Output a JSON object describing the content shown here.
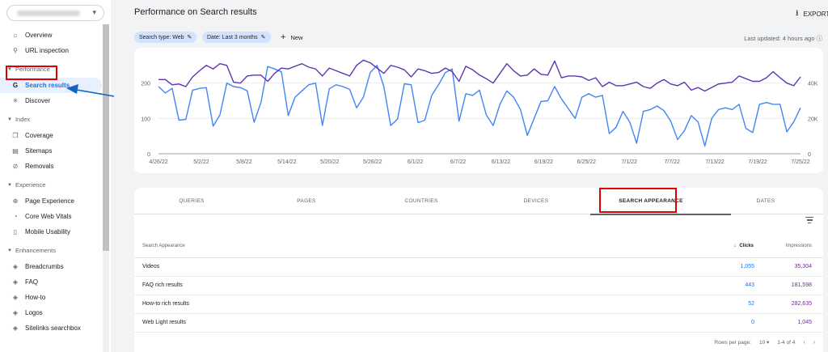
{
  "header": {
    "title": "Performance on Search results",
    "export_label": "EXPORT"
  },
  "sidebar": {
    "top_items": [
      {
        "label": "Overview",
        "icon": "home-icon"
      },
      {
        "label": "URL inspection",
        "icon": "search-icon"
      }
    ],
    "performance": {
      "section": "Performance",
      "items": [
        {
          "label": "Search results",
          "icon": "google-g-icon",
          "active": true
        },
        {
          "label": "Discover",
          "icon": "asterisk-icon"
        }
      ]
    },
    "index": {
      "section": "Index",
      "items": [
        {
          "label": "Coverage",
          "icon": "file-copy-icon"
        },
        {
          "label": "Sitemaps",
          "icon": "sitemap-icon"
        },
        {
          "label": "Removals",
          "icon": "eye-off-icon"
        }
      ]
    },
    "experience": {
      "section": "Experience",
      "items": [
        {
          "label": "Page Experience",
          "icon": "plus-circle-icon"
        },
        {
          "label": "Core Web Vitals",
          "icon": "gauge-icon"
        },
        {
          "label": "Mobile Usability",
          "icon": "phone-icon"
        }
      ]
    },
    "enhancements": {
      "section": "Enhancements",
      "items": [
        {
          "label": "Breadcrumbs",
          "icon": "layers-icon"
        },
        {
          "label": "FAQ",
          "icon": "layers-icon"
        },
        {
          "label": "How-to",
          "icon": "layers-icon"
        },
        {
          "label": "Logos",
          "icon": "layers-icon"
        },
        {
          "label": "Sitelinks searchbox",
          "icon": "layers-icon"
        }
      ]
    }
  },
  "filters": {
    "search_type": "Search type: Web",
    "date": "Date: Last 3 months",
    "new_label": "New",
    "last_updated": "Last updated: 4 hours ago"
  },
  "chart_data": {
    "type": "line",
    "x": [
      "4/26/22",
      "5/2/22",
      "5/8/22",
      "5/14/22",
      "5/20/22",
      "5/26/22",
      "6/1/22",
      "6/7/22",
      "6/13/22",
      "6/19/22",
      "6/25/22",
      "7/1/22",
      "7/7/22",
      "7/13/22",
      "7/19/22",
      "7/25/22"
    ],
    "y_left": {
      "ticks": [
        "0",
        "100",
        "200"
      ],
      "range": [
        0,
        300
      ]
    },
    "y_right": {
      "ticks": [
        "0",
        "20K",
        "40K"
      ],
      "range": [
        0,
        60000
      ]
    },
    "grid": true,
    "series": [
      {
        "color": "#4285f4",
        "axis": "left",
        "values": [
          190,
          172,
          185,
          95,
          97,
          180,
          185,
          187,
          78,
          110,
          200,
          190,
          187,
          178,
          89,
          145,
          247,
          240,
          232,
          108,
          160,
          178,
          195,
          200,
          80,
          184,
          195,
          190,
          182,
          130,
          160,
          230,
          250,
          190,
          80,
          98,
          198,
          195,
          88,
          95,
          165,
          195,
          230,
          240,
          92,
          170,
          165,
          180,
          110,
          80,
          140,
          178,
          160,
          125,
          52,
          100,
          148,
          150,
          190,
          155,
          128,
          100,
          160,
          170,
          160,
          165,
          57,
          75,
          120,
          90,
          30,
          120,
          125,
          135,
          122,
          92,
          40,
          65,
          108,
          90,
          22,
          100,
          125,
          130,
          125,
          140,
          72,
          60,
          140,
          145,
          140,
          140,
          62,
          90,
          130
        ]
      },
      {
        "color": "#5e35b1",
        "axis": "right",
        "values": [
          42000,
          42000,
          39000,
          39500,
          38000,
          43500,
          47000,
          50000,
          48000,
          51000,
          50000,
          40500,
          40000,
          44000,
          44500,
          44500,
          41000,
          45500,
          48500,
          48000,
          49500,
          51000,
          49000,
          48000,
          44000,
          48500,
          47000,
          45500,
          44000,
          50000,
          53000,
          51500,
          48500,
          45500,
          50000,
          49000,
          47500,
          43500,
          48000,
          47000,
          45500,
          46000,
          48500,
          46500,
          41000,
          49500,
          47500,
          44500,
          42500,
          40000,
          45500,
          51000,
          47000,
          44000,
          44500,
          48000,
          45000,
          44500,
          52500,
          43000,
          44000,
          44000,
          43500,
          41500,
          43000,
          38000,
          40500,
          38500,
          38500,
          39500,
          40500,
          38000,
          37000,
          40000,
          42000,
          39500,
          38500,
          40500,
          36000,
          37500,
          35500,
          37500,
          39500,
          40000,
          40500,
          44000,
          42500,
          41000,
          41000,
          43000,
          46500,
          43000,
          40000,
          38500,
          43500
        ]
      }
    ]
  },
  "tabs": [
    "QUERIES",
    "PAGES",
    "COUNTRIES",
    "DEVICES",
    "SEARCH APPEARANCE",
    "DATES"
  ],
  "table": {
    "headers": {
      "name": "Search Appearance",
      "clicks": "Clicks",
      "impressions": "Impressions"
    },
    "rows": [
      {
        "name": "Videos",
        "clicks": "1,055",
        "impressions": "35,304"
      },
      {
        "name": "FAQ rich results",
        "clicks": "443",
        "impressions": "181,598"
      },
      {
        "name": "How-to rich results",
        "clicks": "52",
        "impressions": "282,635"
      },
      {
        "name": "Web Light results",
        "clicks": "0",
        "impressions": "1,045"
      }
    ]
  },
  "pagination": {
    "rows_label": "Rows per page:",
    "rows_value": "10",
    "range": "1-4 of 4"
  },
  "colors": {
    "clicks": "#4285f4",
    "impressions": "#5e35b1",
    "highlight": "#e10000",
    "annotation_arrow": "#1565c0"
  }
}
